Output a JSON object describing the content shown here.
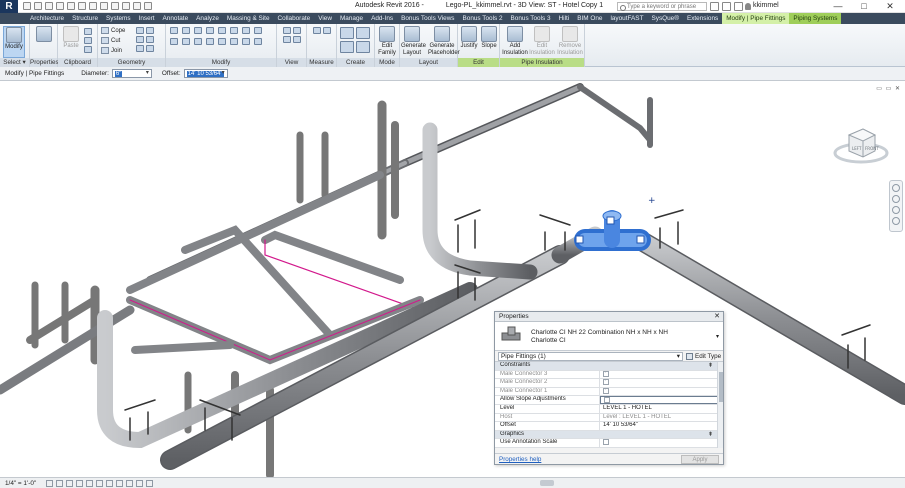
{
  "titlebar": {
    "app_name": "Autodesk Revit 2016 -",
    "document": "Lego-PL_kkimmel.rvt - 3D View: ST - Hotel Copy 1",
    "search_placeholder": "Type a keyword or phrase",
    "user": "kkimmel",
    "minimize": "—",
    "maximize": "□",
    "close": "✕"
  },
  "ribbon_tabs": [
    "Architecture",
    "Structure",
    "Systems",
    "Insert",
    "Annotate",
    "Analyze",
    "Massing & Site",
    "Collaborate",
    "View",
    "Manage",
    "Add-Ins",
    "Bonus Tools Views",
    "Bonus Tools 2",
    "Bonus Tools 3",
    "Hilti",
    "BIM One",
    "layoutFAST",
    "SysQue®",
    "Extensions",
    "Modify | Pipe Fittings",
    "Piping Systems"
  ],
  "active_tab": "Modify | Pipe Fittings",
  "ribbon": {
    "select": {
      "label": "Select ▾",
      "modify": "Modify"
    },
    "properties": {
      "label": "Properties",
      "button": "Properties"
    },
    "clipboard": {
      "label": "Clipboard",
      "paste": "Paste"
    },
    "geometry": {
      "label": "Geometry",
      "cope": "Cope",
      "cut": "Cut",
      "join": "Join"
    },
    "modify": {
      "label": "Modify"
    },
    "view": {
      "label": "View"
    },
    "measure": {
      "label": "Measure"
    },
    "create": {
      "label": "Create"
    },
    "mode": {
      "label": "Mode",
      "edit_family": "Edit Family"
    },
    "layout": {
      "label": "Layout",
      "generate_layout": "Generate Layout",
      "generate_placeholder": "Generate Placeholder"
    },
    "edit": {
      "label": "Edit",
      "justify": "Justify",
      "slope": "Slope"
    },
    "pipe_insulation": {
      "label": "Pipe Insulation",
      "add": "Add Insulation",
      "edit": "Edit Insulation",
      "remove": "Remove Insulation"
    }
  },
  "options_bar": {
    "context": "Modify | Pipe Fittings",
    "diameter_label": "Diameter:",
    "diameter_value": "6\"",
    "offset_label": "Offset:",
    "offset_value": "14'  10 53/64\""
  },
  "viewport": {
    "view_controls": "▭ ▭ ✕",
    "viewcube": {
      "front": "FRONT",
      "left": "LEFT"
    }
  },
  "properties_palette": {
    "title": "Properties",
    "close": "✕",
    "type_name": "Charlotte CI NH 22 Combination NH x NH x NH",
    "type_sub": "Charlotte CI",
    "filter": "Pipe Fittings (1)",
    "edit_type": "Edit Type",
    "rows": [
      {
        "kind": "group",
        "name": "Constraints"
      },
      {
        "kind": "ro",
        "name": "Male Connector 3",
        "check": true
      },
      {
        "kind": "ro",
        "name": "Male Connector 2",
        "check": true
      },
      {
        "kind": "ro",
        "name": "Male Connector 1",
        "check": true
      },
      {
        "kind": "edit",
        "name": "Allow Slope Adjustments",
        "check": false
      },
      {
        "kind": "val",
        "name": "Level",
        "value": "LEVEL 1 - HOTEL"
      },
      {
        "kind": "ro",
        "name": "Host",
        "value": "Level : LEVEL 1 - HOTEL"
      },
      {
        "kind": "val",
        "name": "Offset",
        "value": "14'  10 53/64\""
      },
      {
        "kind": "group",
        "name": "Graphics"
      },
      {
        "kind": "val",
        "name": "Use Annotation Scale",
        "check": false
      }
    ],
    "help": "Properties help",
    "apply": "Apply"
  },
  "status_bar": {
    "scale": "1/4\" = 1'-0\""
  },
  "colors": {
    "ribbon_tab_bg": "#3b4b5e",
    "context_tab": "#9fce5a",
    "pipe": "#8d8f93",
    "fitting_magenta": "#d2198c",
    "selected_fitting": "#4a86e0"
  }
}
